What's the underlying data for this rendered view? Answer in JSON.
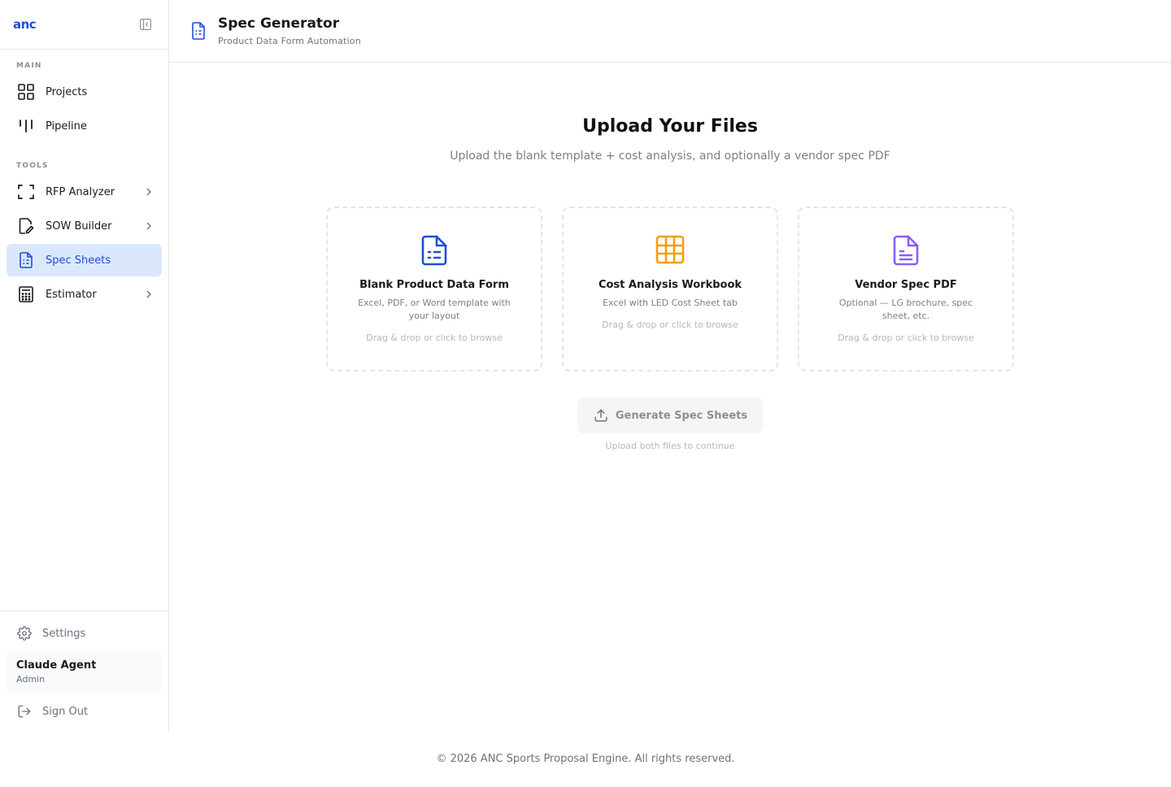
{
  "brand": {
    "logo": "anc"
  },
  "sidebar": {
    "section_main": "MAIN",
    "section_tools": "TOOLS",
    "main_items": [
      {
        "label": "Projects",
        "icon": "grid-icon"
      },
      {
        "label": "Pipeline",
        "icon": "pipeline-icon"
      }
    ],
    "tool_items": [
      {
        "label": "RFP Analyzer",
        "icon": "scan-icon",
        "has_chevron": true
      },
      {
        "label": "SOW Builder",
        "icon": "edit-doc-icon",
        "has_chevron": true
      },
      {
        "label": "Spec Sheets",
        "icon": "spec-doc-icon",
        "active": true
      },
      {
        "label": "Estimator",
        "icon": "calculator-icon",
        "has_chevron": true
      }
    ],
    "settings_label": "Settings",
    "user": {
      "name": "Claude Agent",
      "role": "Admin"
    },
    "signout_label": "Sign Out"
  },
  "header": {
    "title": "Spec Generator",
    "subtitle": "Product Data Form Automation"
  },
  "main": {
    "title": "Upload Your Files",
    "subtitle": "Upload the blank template + cost analysis, and optionally a vendor spec PDF",
    "cards": [
      {
        "title": "Blank Product Data Form",
        "desc": "Excel, PDF, or Word template with your layout",
        "hint": "Drag & drop or click to browse",
        "icon": "document-icon",
        "color": "#1d4ed8"
      },
      {
        "title": "Cost Analysis Workbook",
        "desc": "Excel with LED Cost Sheet tab",
        "hint": "Drag & drop or click to browse",
        "icon": "table-icon",
        "color": "#f59e0b"
      },
      {
        "title": "Vendor Spec PDF",
        "desc": "Optional — LG brochure, spec sheet, etc.",
        "hint": "Drag & drop or click to browse",
        "icon": "file-text-icon",
        "color": "#8b5cf6"
      }
    ],
    "generate_label": "Generate Spec Sheets",
    "generate_hint": "Upload both files to continue"
  },
  "footer": {
    "text": "© 2026 ANC Sports Proposal Engine. All rights reserved."
  },
  "colors": {
    "accent": "#1d4ed8",
    "active_bg": "#dbe8fb"
  }
}
